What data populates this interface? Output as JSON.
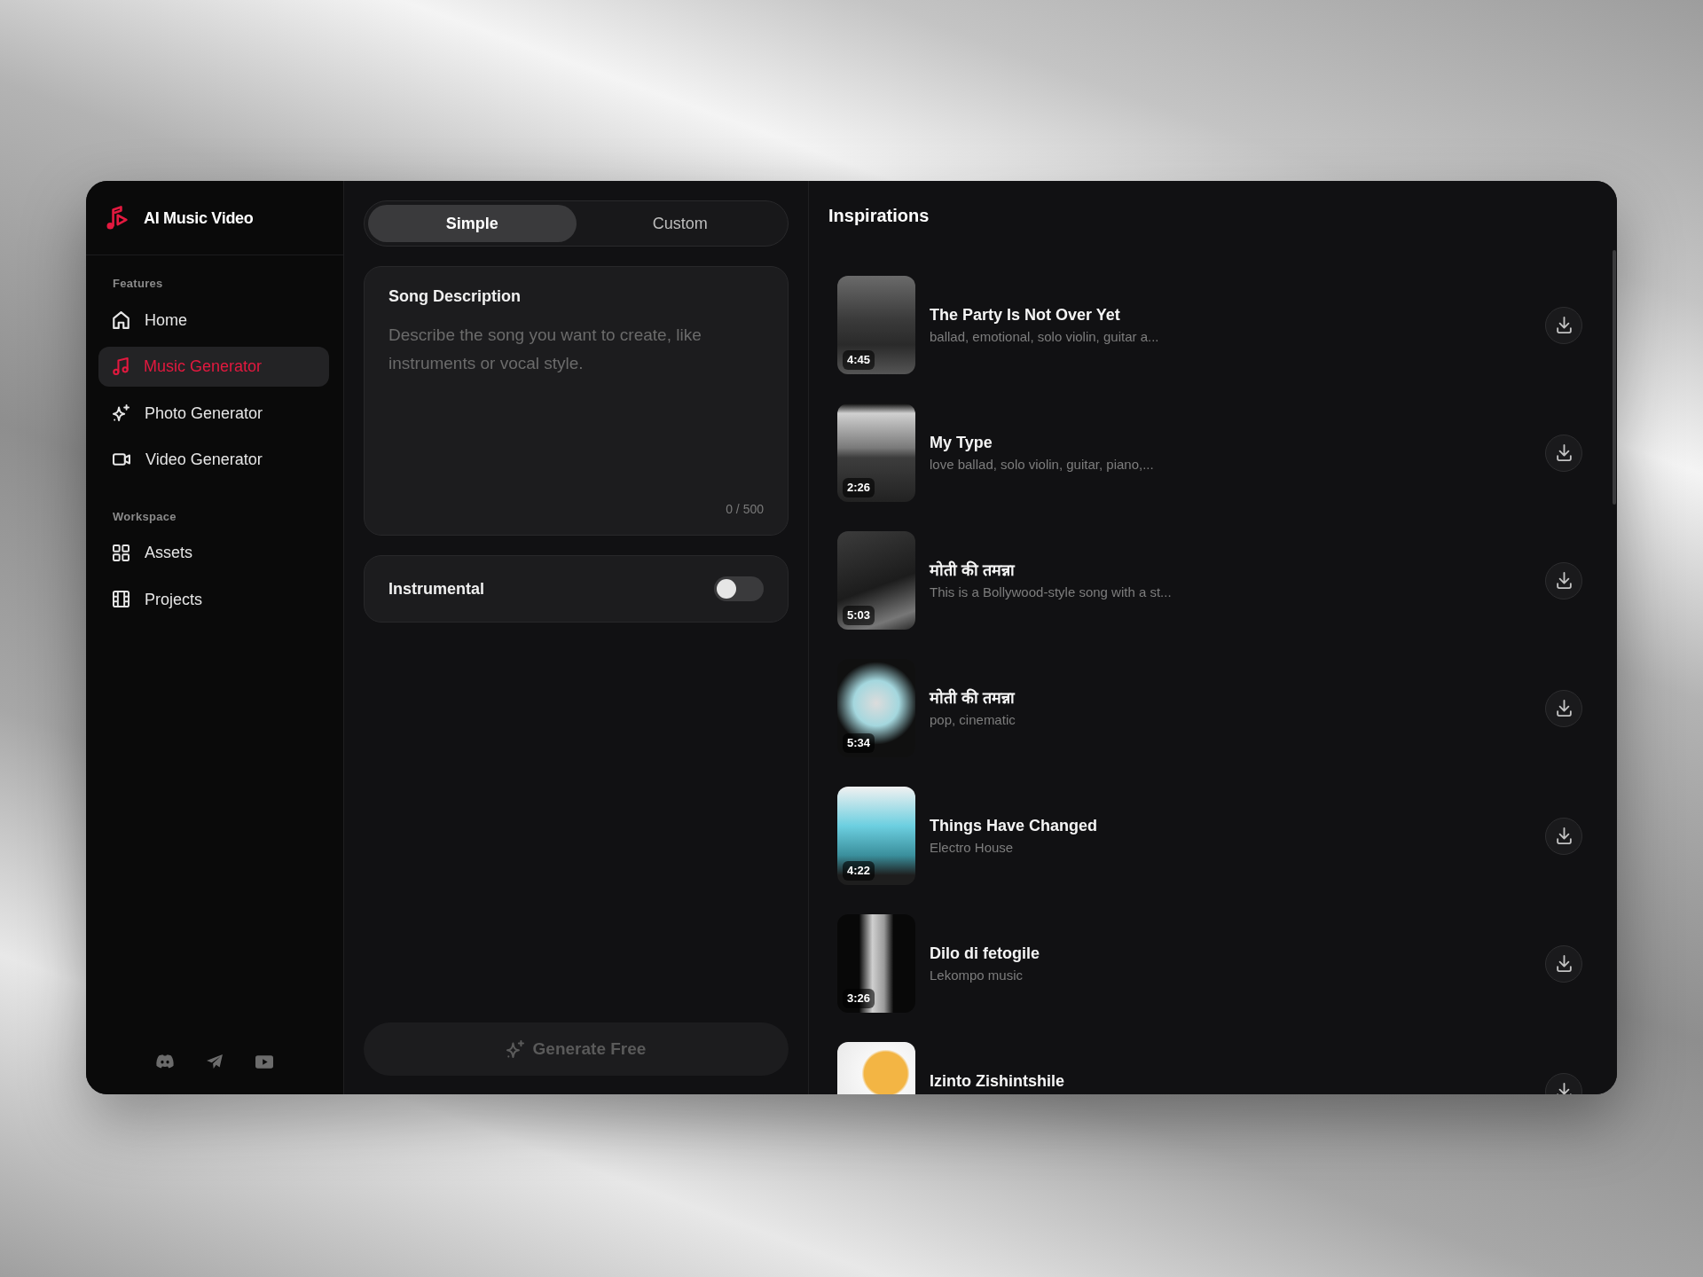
{
  "app": {
    "name": "AI Music Video"
  },
  "sidebar": {
    "sections": [
      {
        "label": "Features",
        "items": [
          {
            "label": "Home",
            "selected": false
          },
          {
            "label": "Music Generator",
            "selected": true
          },
          {
            "label": "Photo Generator",
            "selected": false
          },
          {
            "label": "Video Generator",
            "selected": false
          }
        ]
      },
      {
        "label": "Workspace",
        "items": [
          {
            "label": "Assets",
            "selected": false
          },
          {
            "label": "Projects",
            "selected": false
          }
        ]
      }
    ]
  },
  "generator": {
    "tabs": [
      {
        "label": "Simple",
        "selected": true
      },
      {
        "label": "Custom",
        "selected": false
      }
    ],
    "description": {
      "label": "Song Description",
      "placeholder": "Describe the song you want to create, like instruments or vocal style.",
      "counter": "0 / 500"
    },
    "instrumental": {
      "label": "Instrumental",
      "on": false
    },
    "generate_button": {
      "label": "Generate Free",
      "disabled": true
    }
  },
  "inspirations": {
    "title": "Inspirations",
    "items": [
      {
        "title": "The Party Is Not Over Yet",
        "subtitle": "ballad, emotional, solo violin, guitar a...",
        "duration": "4:45"
      },
      {
        "title": "My Type",
        "subtitle": "love ballad, solo violin, guitar, piano,...",
        "duration": "2:26"
      },
      {
        "title": "मोती की तमन्ना",
        "subtitle": "This is a Bollywood-style song with a st...",
        "duration": "5:03"
      },
      {
        "title": "मोती की तमन्ना",
        "subtitle": "pop, cinematic",
        "duration": "5:34"
      },
      {
        "title": "Things Have Changed",
        "subtitle": "Electro House",
        "duration": "4:22"
      },
      {
        "title": "Dilo di fetogile",
        "subtitle": "Lekompo music",
        "duration": "3:26"
      },
      {
        "title": "Izinto Zishintshile"
      }
    ]
  }
}
